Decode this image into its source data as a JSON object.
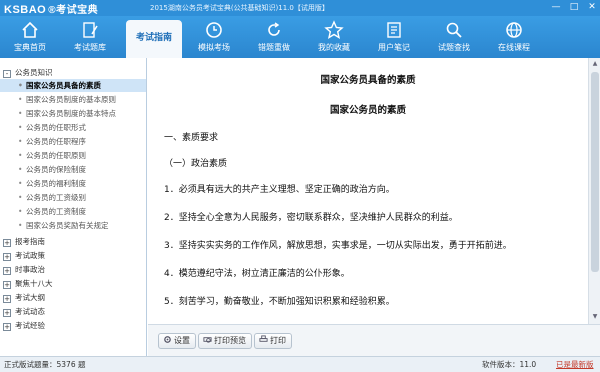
{
  "titlebar": {
    "logo": "KSBAO",
    "logo_cn": "®考试宝典",
    "title": "2015湖南公务员考试宝典(公共基础知识)11.0【试用版】",
    "minimize": "—",
    "maximize": "□",
    "close": "✕"
  },
  "toolbar": {
    "items": [
      {
        "label": "宝典首页",
        "icon": "home-icon"
      },
      {
        "label": "考试题库",
        "icon": "pencil-icon"
      },
      {
        "label": "考试指南",
        "icon": "guide-icon"
      },
      {
        "label": "模拟考场",
        "icon": "clock-icon"
      },
      {
        "label": "错题重做",
        "icon": "redo-icon"
      },
      {
        "label": "我的收藏",
        "icon": "star-icon"
      },
      {
        "label": "用户笔记",
        "icon": "notes-icon"
      },
      {
        "label": "试题查找",
        "icon": "search-icon"
      },
      {
        "label": "在线课程",
        "icon": "globe-icon"
      }
    ],
    "active": "考试指南"
  },
  "sidebar": {
    "root": {
      "label": "公务员知识",
      "toggle": "-"
    },
    "children": [
      "国家公务员具备的素质",
      "国家公务员制度的基本原则",
      "国家公务员制度的基本特点",
      "公务员的任职形式",
      "公务员的任职程序",
      "公务员的任职原则",
      "公务员的保险制度",
      "公务员的福利制度",
      "公务员的工资级别",
      "公务员的工资制度",
      "国家公务员奖励有关规定"
    ],
    "selected": "国家公务员具备的素质",
    "groups": [
      {
        "label": "报考指南",
        "toggle": "+"
      },
      {
        "label": "考试政策",
        "toggle": "+"
      },
      {
        "label": "时事政治",
        "toggle": "+"
      },
      {
        "label": "聚焦十八大",
        "toggle": "+"
      },
      {
        "label": "考试大纲",
        "toggle": "+"
      },
      {
        "label": "考试动态",
        "toggle": "+"
      },
      {
        "label": "考试经验",
        "toggle": "+"
      }
    ]
  },
  "content": {
    "heading": "国家公务员具备的素质",
    "subheading": "国家公务员的素质",
    "paragraphs": [
      "一、素质要求",
      "（一）政治素质",
      "1．必须具有远大的共产主义理想、坚定正确的政治方向。",
      "2．坚持全心全意为人民服务，密切联系群众，坚决维护人民群众的利益。",
      "3．坚持实实实务的工作作风，解放思想，实事求是，一切从实际出发，勇于开拓前进。",
      "4．模范遵纪守法，树立清正廉洁的公仆形象。",
      "5．刻苦学习，勤奋敬业，不断加强知识积累和经验积累。"
    ]
  },
  "actions": {
    "settings": "设置",
    "print_preview": "打印预览",
    "print": "打印"
  },
  "status": {
    "question_count": "正式版试题量：5376 题",
    "version": "软件版本：11.0",
    "link": "已是最新版"
  }
}
